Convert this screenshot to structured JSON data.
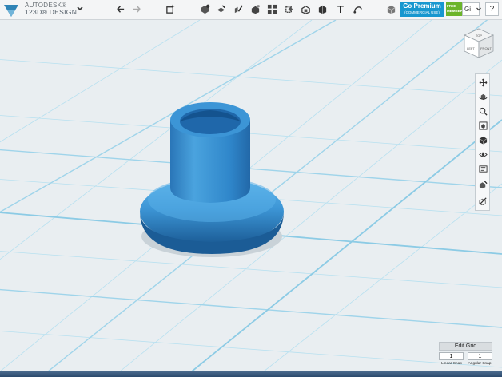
{
  "app": {
    "vendor": "AUTODESK®",
    "product": "123D® DESIGN"
  },
  "toolbar": {
    "tools": [
      {
        "name": "undo-icon"
      },
      {
        "name": "redo-icon"
      },
      {
        "name": "transform-icon"
      },
      {
        "name": "primitives-icon"
      },
      {
        "name": "sketch-icon"
      },
      {
        "name": "construct-icon"
      },
      {
        "name": "modify-icon"
      },
      {
        "name": "pattern-icon"
      },
      {
        "name": "grouping-icon"
      },
      {
        "name": "combine-icon"
      },
      {
        "name": "measure-icon"
      },
      {
        "name": "text-icon",
        "glyph": "T"
      },
      {
        "name": "snap-icon"
      },
      {
        "name": "material-icon"
      }
    ],
    "premium_title": "Go Premium",
    "premium_sub": "(COMMERCIAL USE)",
    "member_label_1": "FREE",
    "member_label_2": "MEMBER",
    "account_value": "Gi",
    "help_label": "?"
  },
  "viewcube": {
    "top_face": "TOP",
    "left_face": "LEFT",
    "front_face": "FRONT"
  },
  "navbar": {
    "items": [
      "pan-icon",
      "orbit-icon",
      "zoom-icon",
      "fit-icon",
      "view-mode-icon",
      "visibility-icon",
      "materials-outlines-icon",
      "show-hide-icon",
      "paint-icon"
    ]
  },
  "grid": {
    "edit_label": "Edit Grid",
    "linear_snap_value": "1",
    "angular_snap_value": "1",
    "linear_snap_label": "Linear Snap",
    "angular_snap_label": "Angular Snap"
  },
  "colors": {
    "accent": "#1797cf",
    "model_blue": "#3a92d0",
    "grid_line": "#9fd4ea",
    "background": "#e9eef1"
  }
}
